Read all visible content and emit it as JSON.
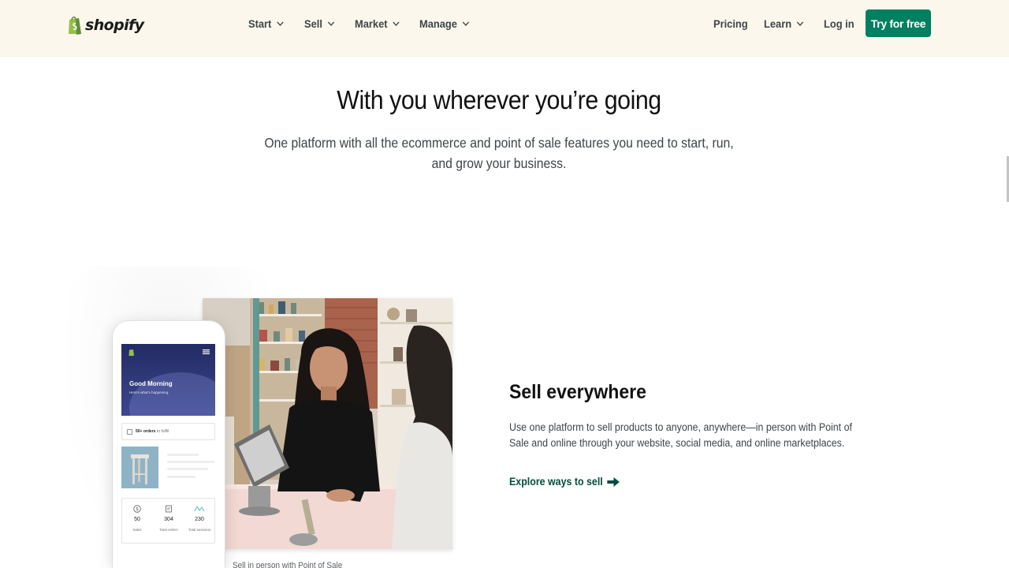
{
  "brand": {
    "name": "shopify",
    "accent": "#008060",
    "header_bg": "#fbf7ed"
  },
  "nav": {
    "items": [
      {
        "label": "Start",
        "icon": "chevron-down-icon"
      },
      {
        "label": "Sell",
        "icon": "chevron-down-icon"
      },
      {
        "label": "Market",
        "icon": "chevron-down-icon"
      },
      {
        "label": "Manage",
        "icon": "chevron-down-icon"
      }
    ],
    "pricing": "Pricing",
    "learn": "Learn",
    "login": "Log in",
    "cta": "Try for free"
  },
  "hero": {
    "title": "With you wherever you’re going",
    "subtitle": "One platform with all the ecommerce and point of sale features you need to start, run, and grow your business."
  },
  "phone_app": {
    "greeting": "Good Morning",
    "greeting_sub": "Here’s what’s happening.",
    "orders_count": "50+ orders",
    "orders_suffix": "to fulfill",
    "stats": [
      {
        "value": "50",
        "label": "Sales",
        "icon": "dollar-icon"
      },
      {
        "value": "304",
        "label": "Total orders",
        "icon": "orders-icon"
      },
      {
        "value": "230",
        "label": "Total sessions",
        "icon": "sessions-graph-icon"
      }
    ]
  },
  "photo_caption": "Sell in person with Point of Sale",
  "feature": {
    "title": "Sell everywhere",
    "body": "Use one platform to sell products to anyone, anywhere—in person with Point of Sale and online through your website, social media, and online marketplaces.",
    "link": "Explore ways to sell",
    "link_icon": "arrow-right-icon"
  }
}
